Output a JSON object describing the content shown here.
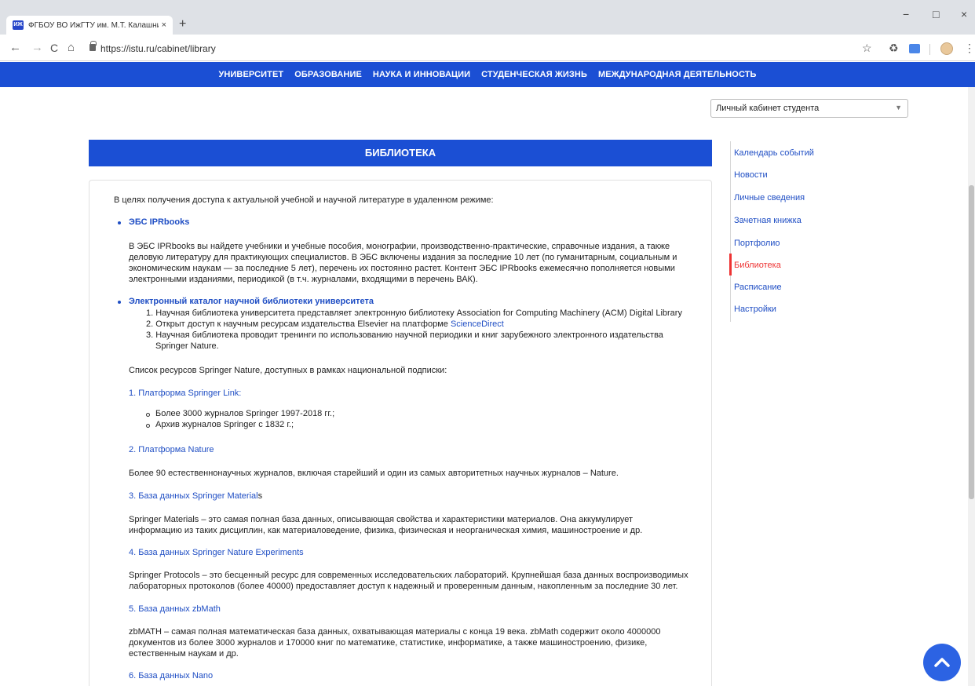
{
  "browser": {
    "tab_title": "ФГБОУ ВО ИжГТУ им. М.Т. Калашникова",
    "favicon_text": "ИЖ",
    "url": "https://istu.ru/cabinet/library",
    "new_tab": "+",
    "tab_close": "×",
    "back": "←",
    "forward": "→",
    "reload": "C",
    "home": "⌂",
    "star": "☆",
    "recycle": "♻",
    "menu": "⋮",
    "minimize": "−",
    "maximize": "□",
    "close": "×"
  },
  "topnav": [
    "УНИВЕРСИТЕТ",
    "ОБРАЗОВАНИЕ",
    "НАУКА И ИННОВАЦИИ",
    "СТУДЕНЧЕСКАЯ ЖИЗНЬ",
    "МЕЖДУНАРОДНАЯ ДЕЯТЕЛЬНОСТЬ"
  ],
  "cabinet_select": {
    "value": "Личный кабинет студента",
    "arrow": "▼"
  },
  "page_title": "БИБЛИОТЕКА",
  "content": {
    "intro": "В целях получения доступа к актуальной учебной и научной литературе в удаленном режиме:",
    "ipr_link": "ЭБС IPRbooks",
    "ipr_text": [
      "В ЭБС IPRbooks вы найдете учебники и учебные пособия, монографии, производственно-практические, справочные издания, а также",
      "деловую литературу для практикующих специалистов. В ЭБС включены издания за последние 10 лет (по гуманитарным, социальным и",
      "экономическим наукам — за последние 5 лет), перечень их постоянно растет. Контент ЭБС IPRbooks ежемесячно пополняется новыми",
      "электронными изданиями, периодикой (в т.ч. журналами, входящими в перечень ВАК)."
    ],
    "catalog_link": "Электронный каталог научной библиотеки университета",
    "catalog_items": {
      "i1": "1. Научная библиотека университета представляет электронную библиотеку Association for Computing Machinery (ACM) Digital Library",
      "i2_prefix": "2. Открыт доступ к научным ресурсам издательства Elsevier на платформе ",
      "i2_link": "ScienceDirect",
      "i3a": "3. Научная библиотека проводит тренинги по использованию научной периодики и книг зарубежного электронного издательства",
      "i3b": "Springer Nature."
    },
    "springer_intro": "Список ресурсов Springer Nature, доступных в рамках национальной подписки:",
    "r1_num": "1. ",
    "r1_link": "Платформа Springer Link:",
    "r1_items": [
      "Более 3000 журналов Springer 1997-2018 гг.;",
      "Архив журналов Springer с 1832 г.;"
    ],
    "r2_num": "2. ",
    "r2_link": "Платформа Nature",
    "r2_text": "Более 90 естественнонаучных журналов, включая старейший и один из самых авторитетных научных журналов – Nature.",
    "r3_num": "3. ",
    "r3_link": "База данных Springer Material",
    "r3_tail": "s",
    "r3_text": [
      "Springer Materials – это самая полная база данных, описывающая свойства и характеристики материалов. Она аккумулирует",
      "информацию из таких дисциплин, как материаловедение, физика, физическая и неорганическая химия, машиностроение и др."
    ],
    "r4_num": "4. ",
    "r4_link": "База данных Springer Nature Experiments",
    "r4_text": [
      "Springer Protocols – это бесценный ресурс для современных исследовательских лабораторий. Крупнейшая база данных воспроизводимых",
      "лабораторных протоколов (более 40000) предоставляет доступ к надежный и проверенным данным, накопленным за последние 30 лет."
    ],
    "r5_num": "5. ",
    "r5_link": "База данных zbMath",
    "r5_text": [
      "zbMATH – самая полная математическая база данных, охватывающая материалы с конца 19 века. zbMath содержит около 4000000",
      "документов из более 3000 журналов и 170000 книг по математике, статистике, информатике, а также машиностроению, физике,",
      "естественным наукам и др."
    ],
    "r6_num": "6. ",
    "r6_link": "База данных Nano"
  },
  "sidebar": [
    "Календарь событий",
    "Новости",
    "Личные сведения",
    "Зачетная книжка",
    "Портфолио",
    "Библиотека",
    "Расписание",
    "Настройки"
  ],
  "active_sidebar": "Библиотека"
}
